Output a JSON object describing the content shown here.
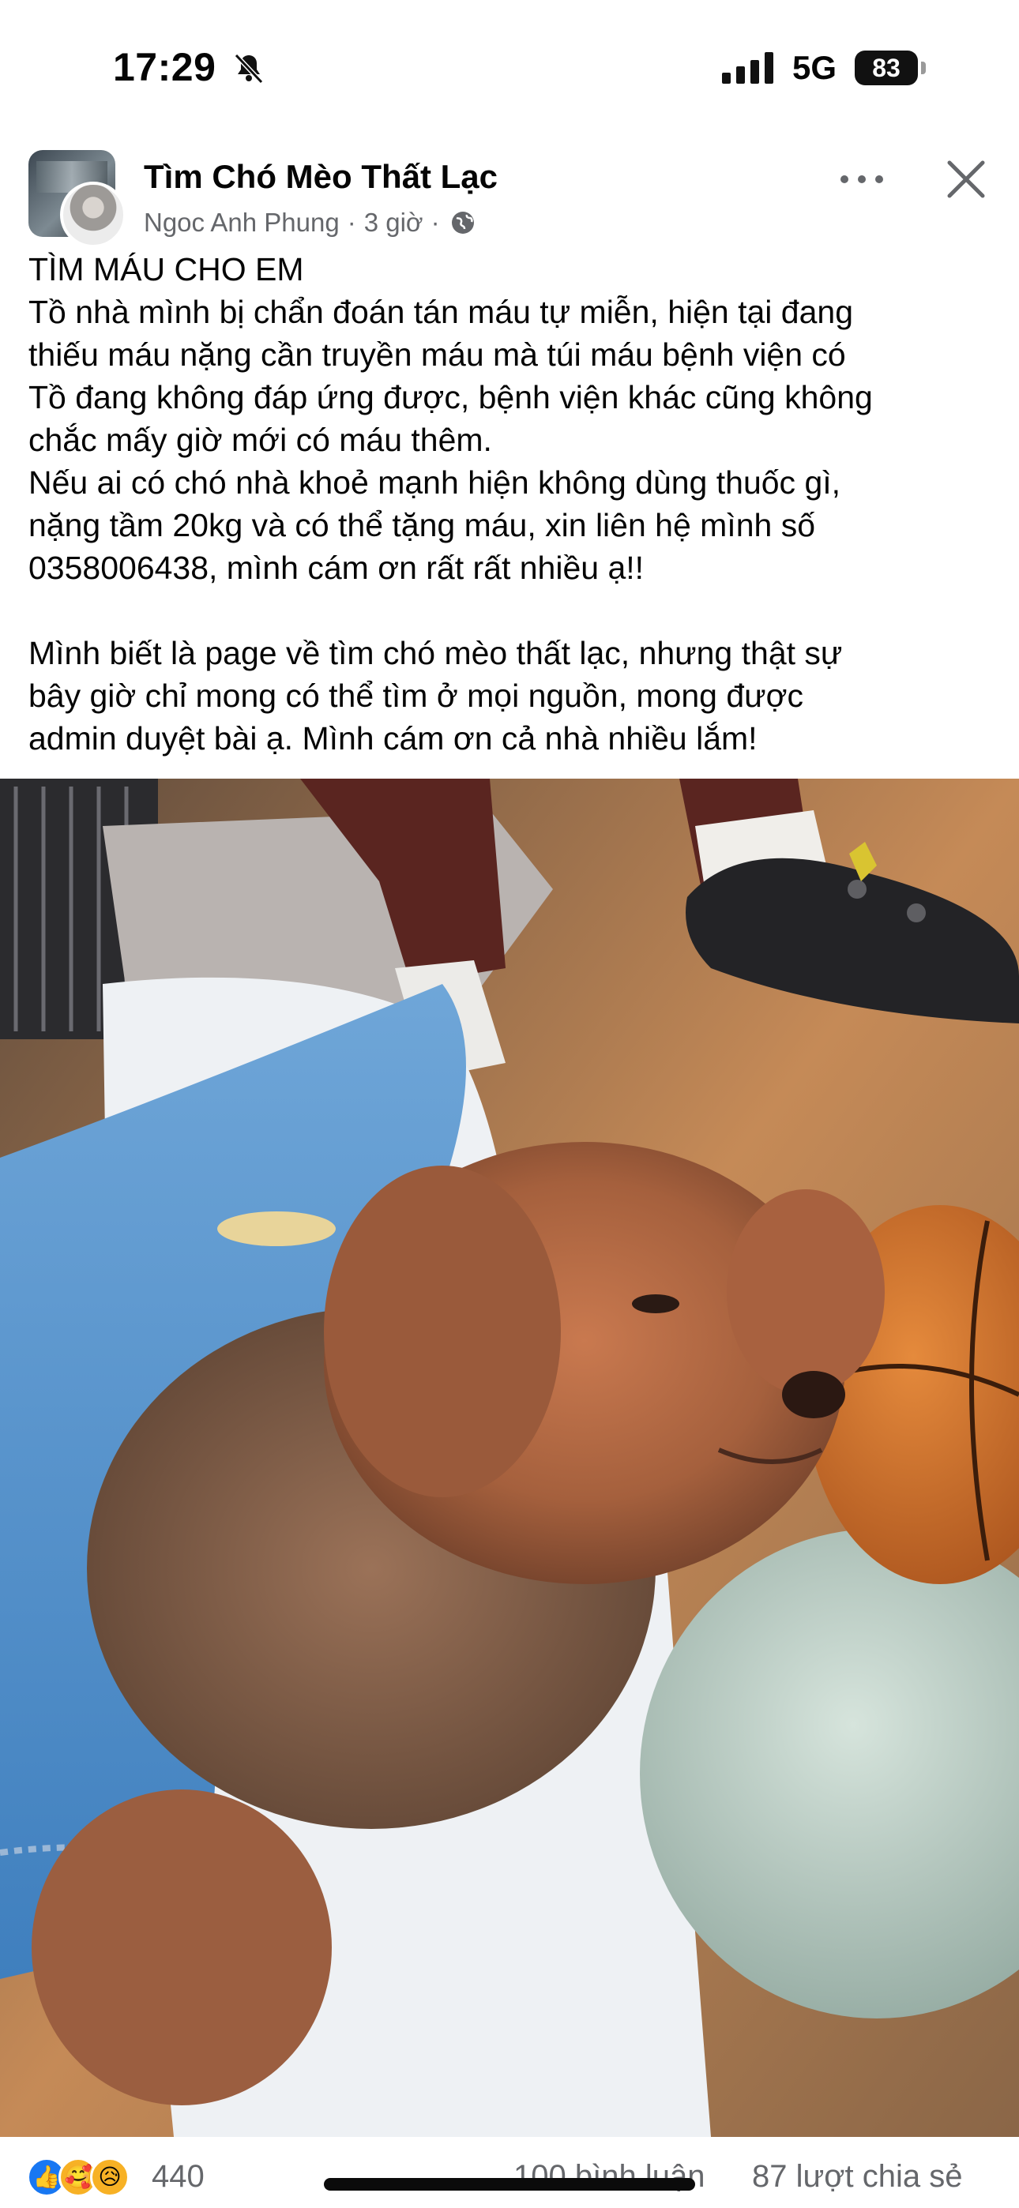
{
  "status_bar": {
    "time": "17:29",
    "network": "5G",
    "battery": "83"
  },
  "post": {
    "group_name": "Tìm Chó Mèo Thất Lạc",
    "author": "Ngoc Anh Phung",
    "separator": "·",
    "time_ago": "3 giờ",
    "privacy_icon": "globe-icon",
    "text_lines": [
      "TÌM MÁU CHO EM",
      "Tồ nhà mình bị chẩn đoán tán máu tự miễn, hiện tại đang",
      "thiếu máu nặng cần truyền máu mà túi máu bệnh viện có",
      "Tồ đang không đáp ứng được, bệnh viện khác cũng không",
      "chắc mấy giờ mới có máu thêm.",
      "Nếu ai có chó nhà khoẻ mạnh hiện không dùng thuốc gì,",
      "nặng tầm 20kg và có thể tặng máu, xin liên hệ mình số",
      "0358006438, mình cám ơn rất rất nhiều ạ!!",
      "",
      "Mình biết là page về tìm chó mèo thất lạc, nhưng thật sự",
      "bây giờ chỉ mong có thể tìm ở mọi nguồn, mong được",
      "admin duyệt bài ạ. Mình cám ơn cả nhà nhiều lắm!"
    ]
  },
  "engagement": {
    "reactions": [
      "like",
      "care",
      "sad"
    ],
    "reaction_count": "440",
    "comments": "100 bình luận",
    "shares": "87 lượt chia sẻ"
  },
  "colors": {
    "text_primary": "#050505",
    "text_secondary": "#65676b",
    "like_blue": "#1877f2",
    "emoji_yellow": "#f7b125"
  }
}
